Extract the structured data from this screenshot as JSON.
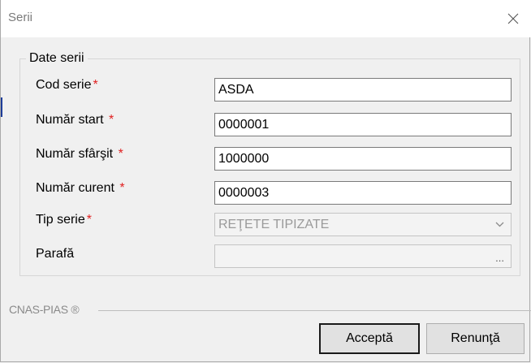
{
  "window": {
    "title": "Serii"
  },
  "group": {
    "title": "Date serii"
  },
  "fields": {
    "cod_serie": {
      "label": "Cod serie",
      "required": "*",
      "value": "ASDA"
    },
    "numar_start": {
      "label": "Număr start",
      "required": "*",
      "value": "0000001"
    },
    "numar_sfarsit": {
      "label": "Număr sfârşit",
      "required": "*",
      "value": "1000000"
    },
    "numar_curent": {
      "label": "Număr curent",
      "required": "*",
      "value": "0000003"
    },
    "tip_serie": {
      "label": "Tip serie",
      "required": "*",
      "value": "REŢETE TIPIZATE"
    },
    "parafa": {
      "label": "Parafă",
      "value": "",
      "button_label": "..."
    }
  },
  "footer": {
    "brand": "CNAS-PIAS ®"
  },
  "buttons": {
    "accept": "Acceptă",
    "cancel": "Renunţă"
  },
  "icons": {
    "close": "close-icon",
    "dropdown": "chevron-down-icon"
  }
}
